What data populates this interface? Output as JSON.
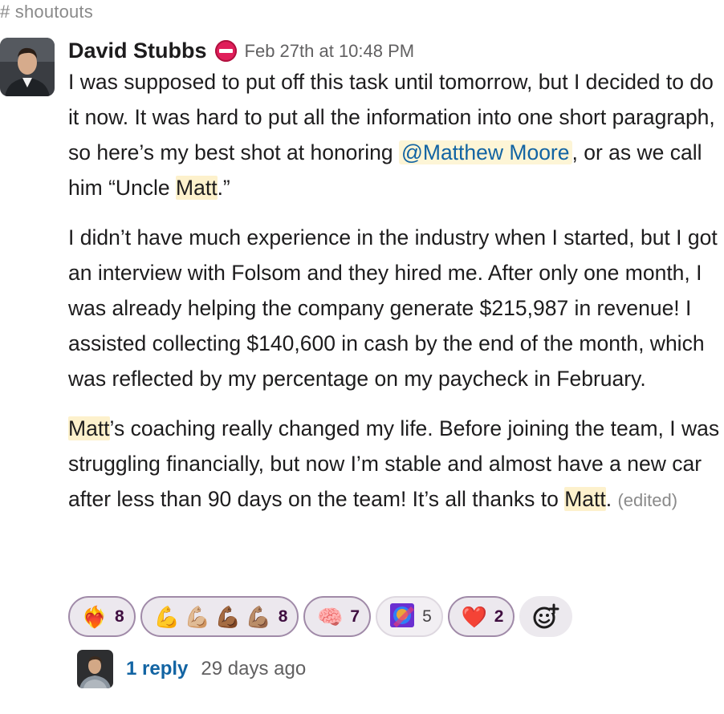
{
  "channel": {
    "name": "# shoutouts"
  },
  "message": {
    "author": "David Stubbs",
    "status": "do-not-disturb-icon",
    "timestamp": "Feb 27th at 10:48 PM",
    "p1_a": "I was supposed to put off this task until tomorrow, but I decided to do it now. It was hard to put all the information into one short paragraph, so here’s my best shot at honoring ",
    "mention": "@Matthew Moore",
    "p1_b": ", or as we call him “Uncle ",
    "p1_hl": "Matt",
    "p1_c": ".”",
    "p2": "I didn’t have much experience in the industry when I started, but I got an interview with Folsom and they hired me. After only one month, I was already helping the company generate $215,987 in revenue! I assisted collecting $140,600 in cash by the end of the month, which was reflected by my percentage on my paycheck in February.",
    "p3_hl1": "Matt",
    "p3_a": "’s coaching really changed my life. Before joining the team, I was struggling financially, but now I’m stable and almost have a new car after less than 90 days on the team! It’s all thanks to ",
    "p3_hl2": "Matt",
    "p3_b": ". ",
    "edited": "(edited)"
  },
  "reactions": [
    {
      "icon": "heart-on-fire-icon",
      "glyph": "❤️‍🔥",
      "count": "8",
      "selected": true
    },
    {
      "icon": "flexed-biceps-skin-tones-icon",
      "glyphs": [
        "💪",
        "💪🏼",
        "💪🏾",
        "💪🏽"
      ],
      "count": "8",
      "selected": true
    },
    {
      "icon": "brain-icon",
      "glyph": "🧠",
      "count": "7",
      "selected": true
    },
    {
      "icon": "custom-emoji-icon",
      "glyph": "",
      "count": "5",
      "selected": false
    },
    {
      "icon": "red-heart-icon",
      "glyph": "❤️",
      "count": "2",
      "selected": true
    }
  ],
  "add_reaction": {
    "icon": "add-reaction-icon",
    "glyph": "☺+"
  },
  "thread": {
    "reply_count": "1 reply",
    "last_reply": "29 days ago"
  },
  "colors": {
    "link": "#1264a3",
    "highlight": "#fdf1cc",
    "dnd": "#e01e5a",
    "reaction_border": "#a08aa8"
  }
}
